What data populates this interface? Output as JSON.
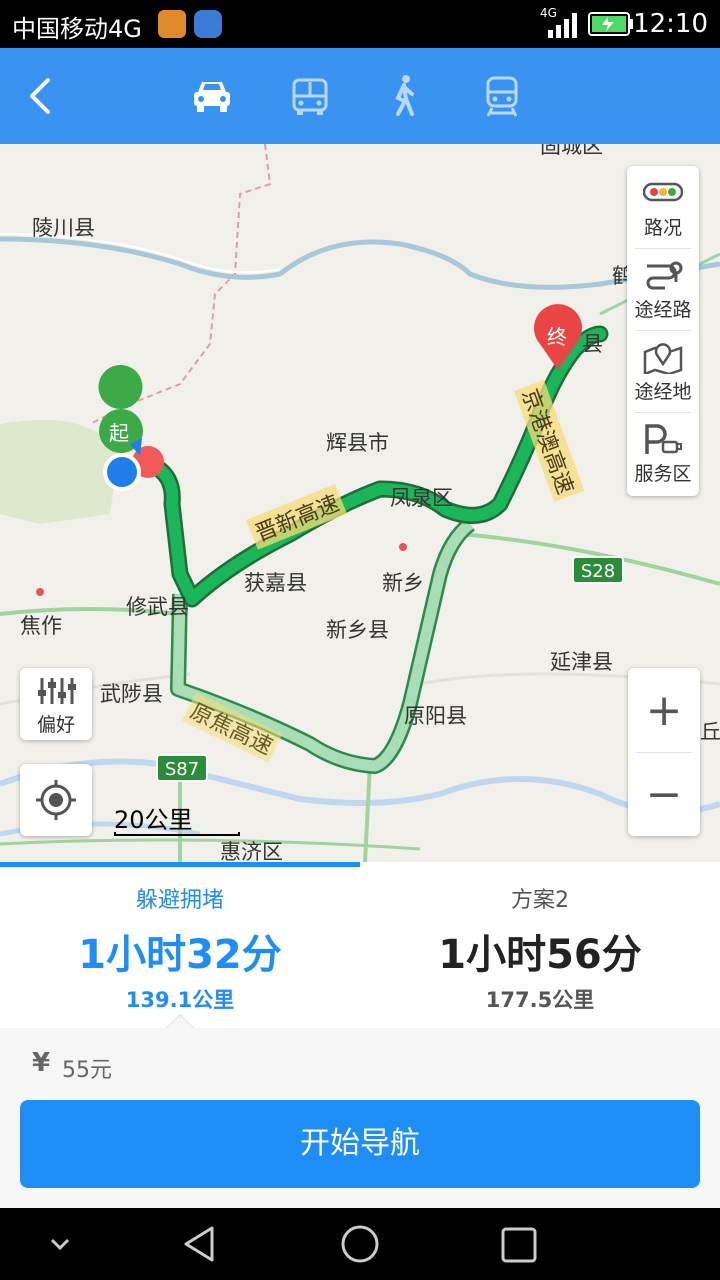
{
  "status_bar": {
    "carrier": "中国移动4G",
    "network": "4G",
    "time": "12:10"
  },
  "header": {
    "back_icon": "chevron-left-icon",
    "modes": [
      {
        "name": "car",
        "icon": "car-icon",
        "selected": true
      },
      {
        "name": "bus",
        "icon": "bus-icon",
        "selected": false
      },
      {
        "name": "walk",
        "icon": "walk-icon",
        "selected": false
      },
      {
        "name": "train",
        "icon": "train-icon",
        "selected": false
      }
    ]
  },
  "map": {
    "labels": {
      "lingchuan": "陵川县",
      "huixian": "辉县市",
      "fengquan": "凤泉区",
      "huojia": "获嘉县",
      "xinxiang": "新乡",
      "xinxiangxian": "新乡县",
      "xiuwu": "修武县",
      "jiaozuo": "焦作",
      "wuzhi": "武陟县",
      "yuanyang": "原阳县",
      "yanjin": "延津县",
      "huiji": "惠济区",
      "xian_end": "县",
      "gaocheng": "固城区",
      "right_cut": "鹤",
      "right_cut2": "丘县"
    },
    "road_labels": {
      "jinxin": "晋新高速",
      "jinggang": "京港澳高速",
      "yuanjiao": "原焦高速"
    },
    "road_shields": {
      "s28": "S28",
      "s87": "S87"
    },
    "markers": {
      "start": "起",
      "end": "终"
    },
    "scale": "20公里",
    "tools": [
      {
        "label": "路况",
        "icon": "traffic-icon"
      },
      {
        "label": "途经路",
        "icon": "route-via-icon"
      },
      {
        "label": "途经地",
        "icon": "map-pin-icon"
      },
      {
        "label": "服务区",
        "icon": "parking-service-icon"
      }
    ],
    "preference_label": "偏好",
    "zoom_in": "+",
    "zoom_out": "−"
  },
  "plans": [
    {
      "name": "躲避拥堵",
      "duration": "1小时32分",
      "distance": "139.1公里",
      "selected": true
    },
    {
      "name": "方案2",
      "duration": "1小时56分",
      "distance": "177.5公里",
      "selected": false
    }
  ],
  "toll": {
    "symbol": "¥",
    "amount": "55元"
  },
  "start_nav_label": "开始导航",
  "colors": {
    "accent": "#3A93F0",
    "route": "#1CB65A",
    "route_alt": "#A9DDB5",
    "button": "#1E8DF6"
  }
}
